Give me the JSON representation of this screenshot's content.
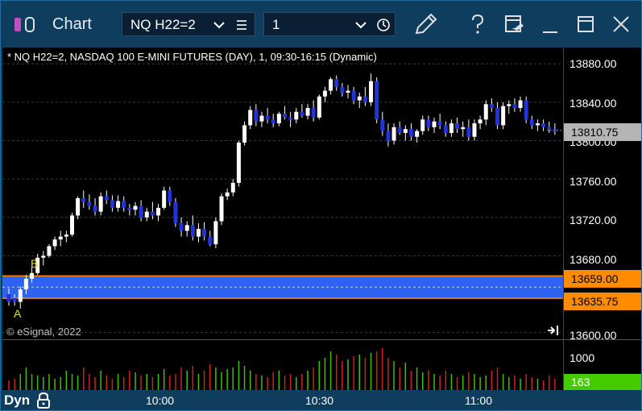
{
  "window": {
    "title": "Chart",
    "symbol": "NQ H22=2",
    "interval": "1",
    "icons": [
      "link-toggle-icon",
      "chevron-down-icon",
      "menu-icon",
      "chevron-down-icon",
      "clock-icon",
      "pencil-icon",
      "help-icon",
      "template-icon",
      "minimize-icon",
      "maximize-icon",
      "close-icon"
    ]
  },
  "chart": {
    "info_line": "* NQ H22=2, NASDAQ 100 E-MINI FUTURES (DAY), 1, 09:30-16:15 (Dynamic)",
    "copyright": "© eSignal, 2022",
    "marker_a": "A",
    "marker_b": "B",
    "zone_color": "#2e62f2",
    "zone_border": "#ff8c00",
    "up_color": "#ffffff",
    "down_color": "#2233dd"
  },
  "price_scale": {
    "labels": [
      "13880.00",
      "13840.00",
      "13800.00",
      "13760.00",
      "13720.00",
      "13680.00",
      "13600.00"
    ],
    "current": "13810.75",
    "zone_high": "13659.00",
    "zone_low": "13635.75"
  },
  "volume_scale": {
    "label": "1000",
    "current": "163",
    "current_color": "#44cc00"
  },
  "bottom_bar": {
    "mode": "Dyn",
    "times": [
      "10:00",
      "10:30",
      "11:00"
    ]
  },
  "chart_data": {
    "type": "candlestick",
    "ylim": [
      13593,
      13897
    ],
    "zone": {
      "high": 13659.0,
      "low": 13635.75
    },
    "last": 13810.75,
    "ohlc": [
      [
        13640,
        13646,
        13628,
        13632
      ],
      [
        13636,
        13640,
        13628,
        13632
      ],
      [
        13632,
        13648,
        13625,
        13645
      ],
      [
        13645,
        13660,
        13640,
        13656
      ],
      [
        13656,
        13668,
        13652,
        13662
      ],
      [
        13662,
        13682,
        13660,
        13678
      ],
      [
        13678,
        13685,
        13670,
        13680
      ],
      [
        13680,
        13692,
        13678,
        13690
      ],
      [
        13690,
        13700,
        13686,
        13697
      ],
      [
        13697,
        13706,
        13690,
        13700
      ],
      [
        13700,
        13706,
        13694,
        13702
      ],
      [
        13702,
        13725,
        13700,
        13722
      ],
      [
        13722,
        13742,
        13718,
        13740
      ],
      [
        13740,
        13748,
        13730,
        13736
      ],
      [
        13736,
        13744,
        13728,
        13732
      ],
      [
        13732,
        13740,
        13722,
        13726
      ],
      [
        13726,
        13746,
        13722,
        13742
      ],
      [
        13742,
        13748,
        13734,
        13738
      ],
      [
        13738,
        13743,
        13726,
        13730
      ],
      [
        13730,
        13743,
        13726,
        13737
      ],
      [
        13737,
        13742,
        13726,
        13730
      ],
      [
        13730,
        13734,
        13722,
        13728
      ],
      [
        13728,
        13736,
        13722,
        13732
      ],
      [
        13732,
        13738,
        13716,
        13720
      ],
      [
        13720,
        13730,
        13716,
        13726
      ],
      [
        13726,
        13736,
        13718,
        13722
      ],
      [
        13722,
        13734,
        13716,
        13730
      ],
      [
        13730,
        13752,
        13728,
        13748
      ],
      [
        13748,
        13752,
        13732,
        13736
      ],
      [
        13736,
        13740,
        13710,
        13714
      ],
      [
        13714,
        13720,
        13700,
        13706
      ],
      [
        13706,
        13716,
        13700,
        13712
      ],
      [
        13712,
        13722,
        13696,
        13700
      ],
      [
        13700,
        13714,
        13694,
        13708
      ],
      [
        13708,
        13715,
        13696,
        13700
      ],
      [
        13700,
        13706,
        13690,
        13692
      ],
      [
        13692,
        13720,
        13688,
        13716
      ],
      [
        13716,
        13745,
        13712,
        13742
      ],
      [
        13742,
        13750,
        13738,
        13746
      ],
      [
        13746,
        13760,
        13742,
        13756
      ],
      [
        13756,
        13800,
        13752,
        13798
      ],
      [
        13798,
        13820,
        13795,
        13816
      ],
      [
        13816,
        13836,
        13812,
        13832
      ],
      [
        13832,
        13838,
        13815,
        13820
      ],
      [
        13820,
        13830,
        13814,
        13826
      ],
      [
        13826,
        13834,
        13818,
        13822
      ],
      [
        13822,
        13828,
        13814,
        13818
      ],
      [
        13818,
        13830,
        13815,
        13828
      ],
      [
        13828,
        13836,
        13822,
        13824
      ],
      [
        13824,
        13830,
        13814,
        13822
      ],
      [
        13822,
        13834,
        13818,
        13830
      ],
      [
        13830,
        13838,
        13824,
        13826
      ],
      [
        13826,
        13838,
        13822,
        13834
      ],
      [
        13834,
        13842,
        13820,
        13824
      ],
      [
        13824,
        13848,
        13822,
        13846
      ],
      [
        13846,
        13856,
        13840,
        13852
      ],
      [
        13852,
        13866,
        13848,
        13864
      ],
      [
        13864,
        13868,
        13852,
        13856
      ],
      [
        13856,
        13860,
        13846,
        13850
      ],
      [
        13850,
        13858,
        13844,
        13852
      ],
      [
        13852,
        13856,
        13838,
        13842
      ],
      [
        13842,
        13850,
        13834,
        13846
      ],
      [
        13846,
        13856,
        13836,
        13840
      ],
      [
        13840,
        13870,
        13836,
        13862
      ],
      [
        13862,
        13866,
        13818,
        13822
      ],
      [
        13822,
        13830,
        13805,
        13810
      ],
      [
        13810,
        13818,
        13794,
        13800
      ],
      [
        13800,
        13818,
        13796,
        13814
      ],
      [
        13814,
        13820,
        13806,
        13808
      ],
      [
        13808,
        13816,
        13800,
        13812
      ],
      [
        13812,
        13818,
        13800,
        13804
      ],
      [
        13804,
        13812,
        13798,
        13810
      ],
      [
        13810,
        13826,
        13806,
        13822
      ],
      [
        13822,
        13826,
        13810,
        13814
      ],
      [
        13814,
        13824,
        13808,
        13820
      ],
      [
        13820,
        13828,
        13812,
        13816
      ],
      [
        13816,
        13820,
        13804,
        13808
      ],
      [
        13808,
        13822,
        13804,
        13818
      ],
      [
        13818,
        13824,
        13808,
        13812
      ],
      [
        13812,
        13820,
        13804,
        13814
      ],
      [
        13814,
        13822,
        13800,
        13804
      ],
      [
        13804,
        13822,
        13800,
        13818
      ],
      [
        13818,
        13826,
        13812,
        13822
      ],
      [
        13822,
        13842,
        13816,
        13838
      ],
      [
        13838,
        13844,
        13830,
        13834
      ],
      [
        13834,
        13840,
        13812,
        13816
      ],
      [
        13816,
        13840,
        13812,
        13836
      ],
      [
        13836,
        13842,
        13828,
        13838
      ],
      [
        13838,
        13844,
        13830,
        13834
      ],
      [
        13834,
        13846,
        13830,
        13842
      ],
      [
        13842,
        13846,
        13818,
        13822
      ],
      [
        13822,
        13826,
        13812,
        13816
      ],
      [
        13816,
        13822,
        13810,
        13818
      ],
      [
        13818,
        13822,
        13810,
        13814
      ],
      [
        13814,
        13820,
        13808,
        13812
      ],
      [
        13812,
        13818,
        13806,
        13810
      ]
    ],
    "volume": [
      300,
      350,
      500,
      700,
      500,
      450,
      400,
      500,
      350,
      400,
      600,
      500,
      450,
      700,
      500,
      400,
      600,
      450,
      350,
      500,
      400,
      600,
      550,
      450,
      500,
      400,
      500,
      650,
      450,
      500,
      700,
      600,
      750,
      500,
      600,
      800,
      700,
      550,
      650,
      700,
      900,
      750,
      600,
      500,
      450,
      400,
      550,
      600,
      450,
      500,
      400,
      500,
      600,
      700,
      900,
      1000,
      1200,
      1100,
      900,
      950,
      1050,
      1100,
      1000,
      1150,
      1200,
      1300,
      1000,
      900,
      700,
      850,
      600,
      700,
      550,
      600,
      500,
      450,
      600,
      500,
      400,
      450,
      550,
      500,
      400,
      450,
      600,
      700,
      500,
      400,
      450,
      350,
      500,
      400,
      350,
      300,
      450,
      350
    ],
    "vol_max": 1500
  }
}
